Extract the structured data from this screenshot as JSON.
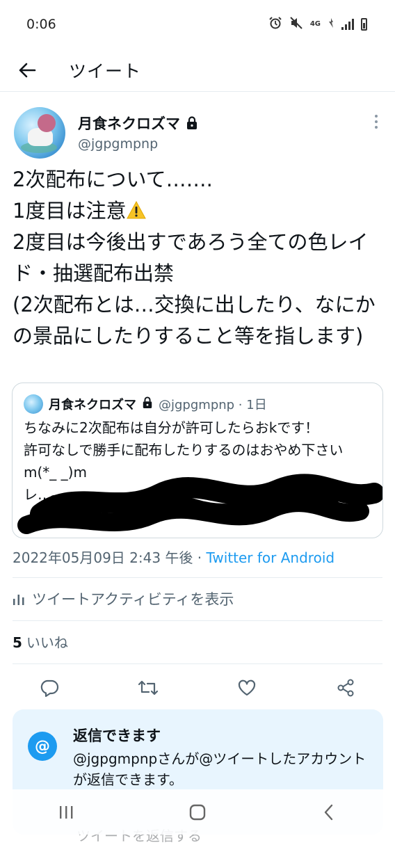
{
  "status_bar": {
    "time": "0:06",
    "network": "4G",
    "icons": [
      "alarm-icon",
      "mute-icon",
      "wifi-icon",
      "signal-icon",
      "battery-icon"
    ]
  },
  "header": {
    "back_icon": "arrow-left-icon",
    "title": "ツイート"
  },
  "tweet": {
    "author": {
      "display_name": "月食ネクロズマ",
      "handle": "@jgpgmpnp",
      "protected": true
    },
    "text_lines": [
      "2次配布について…….",
      "1度目は注意",
      "2度目は今後出すであろう全ての色レイド・抽選配布出禁",
      "(2次配布とは…交換に出したり、なにかの景品にしたりすること等を指します)"
    ],
    "quote": {
      "display_name": "月食ネクロズマ",
      "handle_time": "@jgpgmpnp · 1日",
      "text": "ちなみに2次配布は自分が許可したらおkです！\n許可なしで勝手に配布したりするのはおやめ下さいm(*_ _)m\nレ…\n…"
    },
    "timestamp": "2022年05月09日 2:43 午後 · ",
    "source": "Twitter for Android",
    "activity_label": "ツイートアクティビティを表示",
    "likes_count": "5",
    "likes_label": "いいね"
  },
  "actions": [
    "reply-icon",
    "retweet-icon",
    "like-icon",
    "share-icon"
  ],
  "reply_notice": {
    "title": "返信できます",
    "body": "@jgpgmpnpさんが@ツイートしたアカウントが返信できます。",
    "peek_text": "ツイートを返信する"
  },
  "colors": {
    "accent": "#1d9bf0",
    "secondary_text": "#536471",
    "notice_bg": "#e8f5fe"
  }
}
